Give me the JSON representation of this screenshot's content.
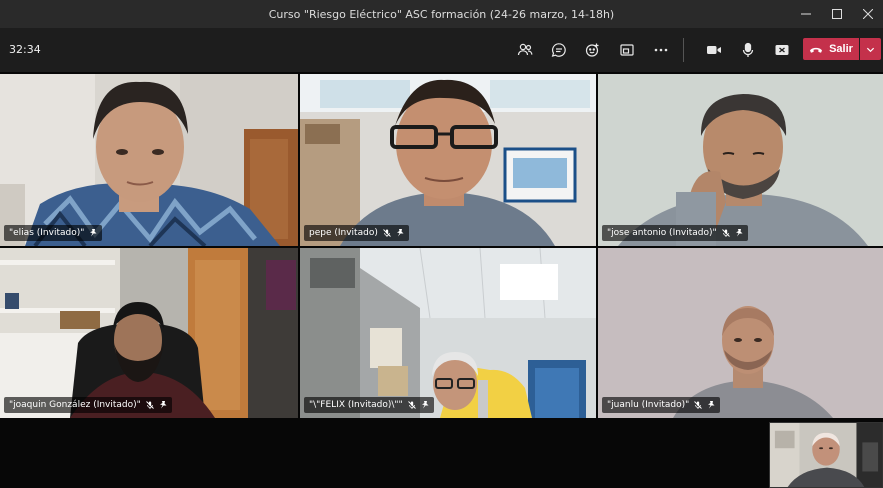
{
  "window": {
    "title": "Curso \"Riesgo Eléctrico\" ASC formación (24-26 marzo, 14-18h)",
    "controls": [
      "minimize-icon",
      "maximize-icon",
      "close-icon"
    ]
  },
  "toolbar": {
    "timer": "32:34",
    "icons": [
      "participants-icon",
      "chat-icon",
      "reactions-icon",
      "share-tray-icon",
      "more-options-icon",
      "camera-icon",
      "microphone-icon",
      "share-screen-icon"
    ],
    "leave_label": "Salir",
    "leave_color": "#c4314b"
  },
  "participants": [
    {
      "name": "\"elias (Invitado)\"",
      "muted": false,
      "pinned": true
    },
    {
      "name": "pepe (Invitado)",
      "muted": true,
      "pinned": true
    },
    {
      "name": "\"jose antonio (Invitado)\"",
      "muted": true,
      "pinned": true
    },
    {
      "name": "\"joaquin González (Invitado)\"",
      "muted": true,
      "pinned": true
    },
    {
      "name": "\"\\\"FELIX (Invitado)\\\"\"",
      "muted": true,
      "pinned": true
    },
    {
      "name": "\"juanlu (Invitado)\"",
      "muted": true,
      "pinned": true
    }
  ]
}
